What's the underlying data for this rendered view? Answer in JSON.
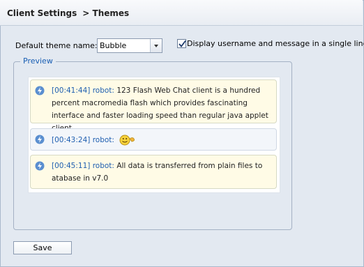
{
  "header": {
    "section": "Client Settings",
    "page": "> Themes"
  },
  "theme": {
    "label": "Default theme name:",
    "selected": "Bubble"
  },
  "single_line": {
    "checked": true,
    "label": "Display username and message in a single line"
  },
  "preview": {
    "legend": "Preview",
    "messages": [
      {
        "time": "[00:41:44]",
        "user": "robot:",
        "text": "123 Flash Web Chat client is a hundred percent macromedia flash which provides fascinating interface and faster loading speed than regular java applet client."
      },
      {
        "time": "[00:43:24]",
        "user": "robot:",
        "text": "",
        "emoticon": "smiley-face-icon"
      },
      {
        "time": "[00:45:11]",
        "user": "robot:",
        "text": "All data is transferred from plain files to atabase  in v7.0"
      }
    ]
  },
  "actions": {
    "save_label": "Save"
  }
}
